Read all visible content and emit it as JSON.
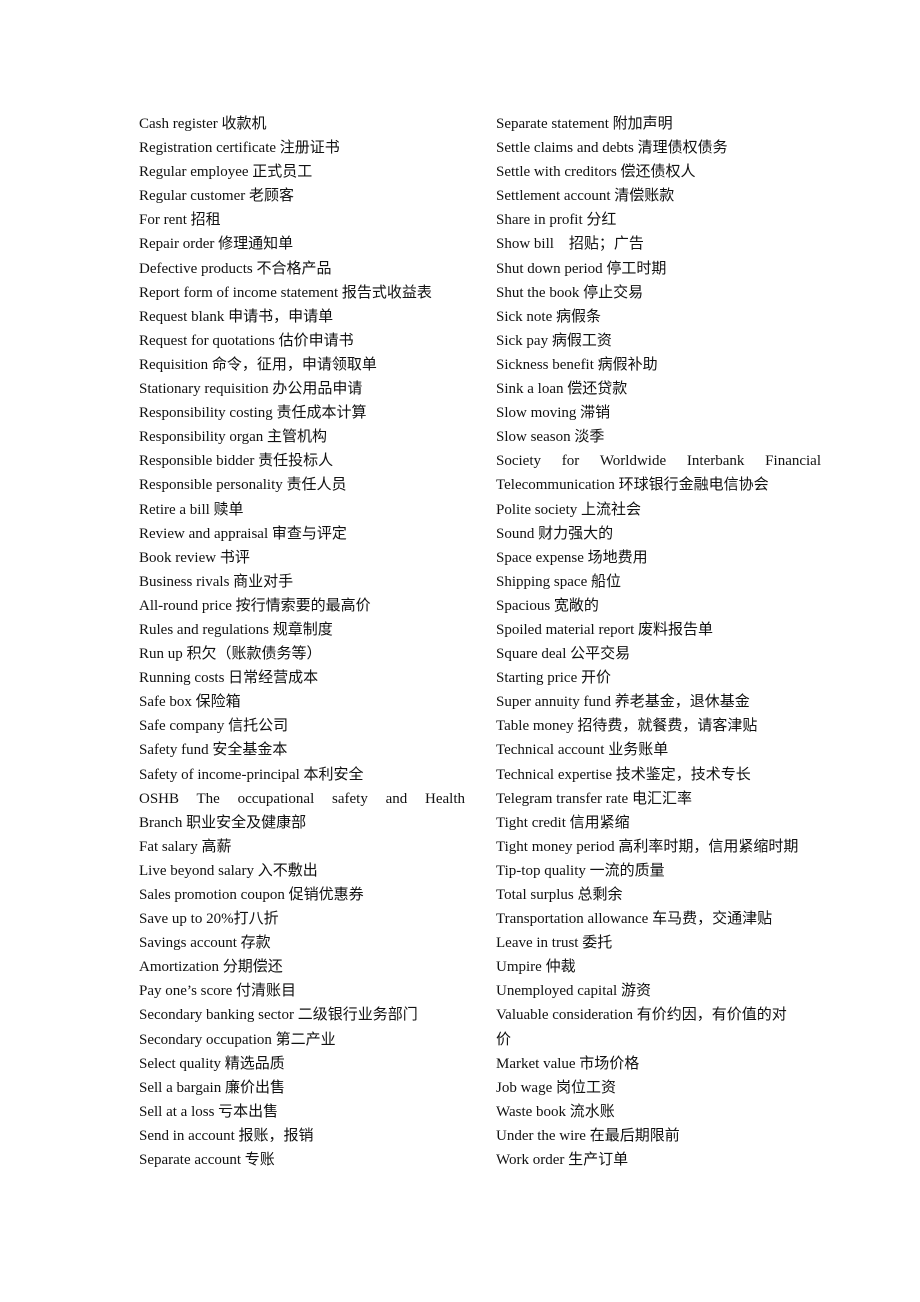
{
  "document": {
    "left_column": [
      "Cash register 收款机",
      "Registration certificate 注册证书",
      "Regular employee 正式员工",
      "Regular customer 老顾客",
      "For rent 招租",
      "Repair order 修理通知单",
      "Defective products 不合格产品",
      "Report form of income statement 报告式收益表",
      "Request blank 申请书，申请单",
      "Request for quotations 估价申请书",
      "Requisition 命令，征用，申请领取单",
      "Stationary requisition 办公用品申请",
      "Responsibility costing 责任成本计算",
      "Responsibility organ 主管机构",
      "Responsible bidder 责任投标人",
      "Responsible personality 责任人员",
      "Retire a bill 赎单",
      "Review and appraisal 审查与评定",
      "Book review 书评",
      "Business rivals 商业对手",
      "All-round price 按行情索要的最高价",
      "Rules and regulations 规章制度",
      "Run up 积欠（账款债务等）",
      "Running costs 日常经营成本",
      "Safe box 保险箱",
      "Safe company 信托公司",
      "Safety fund 安全基金本",
      "Safety of income-principal 本利安全",
      "OSHB The occupational safety and Health",
      "Branch 职业安全及健康部",
      "Fat salary 高薪",
      "Live beyond salary 入不敷出",
      "Sales promotion coupon 促销优惠券",
      "Save up to 20%打八折",
      "Savings account 存款",
      "Amortization 分期偿还",
      "Pay one’s score 付清账目",
      "Secondary banking sector 二级银行业务部门",
      "Secondary occupation 第二产业",
      "Select quality 精选品质",
      "Sell a bargain 廉价出售",
      "Sell at a loss 亏本出售",
      "Send in account 报账，报销",
      "Separate account 专账"
    ],
    "right_column": [
      "Separate statement 附加声明",
      "Settle claims and debts 清理债权债务",
      "Settle with creditors 偿还债权人",
      "Settlement account 清偿账款",
      "Share in profit 分红",
      "Show bill　招贴；广告",
      "Shut down period 停工时期",
      "Shut the book 停止交易",
      "Sick note 病假条",
      "Sick pay 病假工资",
      "Sickness benefit 病假补助",
      "Sink a loan 偿还贷款",
      "Slow moving 滞销",
      "Slow season 淡季",
      "Society for Worldwide Interbank Financial",
      "Telecommunication  环球银行金融电信协会",
      "Polite society 上流社会",
      "Sound 财力强大的",
      "Space expense 场地费用",
      "Shipping space 船位",
      "Spacious 宽敞的",
      "Spoiled material report 废料报告单",
      "Square deal 公平交易",
      "Starting price 开价",
      "Super annuity fund 养老基金，退休基金",
      "Table money 招待费，就餐费，请客津贴",
      "Technical account 业务账单",
      "Technical expertise 技术鉴定，技术专长",
      "Telegram transfer rate 电汇汇率",
      "Tight credit 信用紧缩",
      "Tight money period  高利率时期，信用紧缩时期",
      "Tip-top quality 一流的质量",
      "Total surplus 总剩余",
      "Transportation allowance 车马费，交通津贴",
      "Leave in trust 委托",
      "Umpire 仲裁",
      "Unemployed capital 游资",
      "Valuable consideration 有价约因，有价值的对",
      "价",
      "Market value 市场价格",
      "Job wage 岗位工资",
      "Waste book 流水账",
      "Under the wire  在最后期限前",
      "Work order 生产订单"
    ]
  }
}
